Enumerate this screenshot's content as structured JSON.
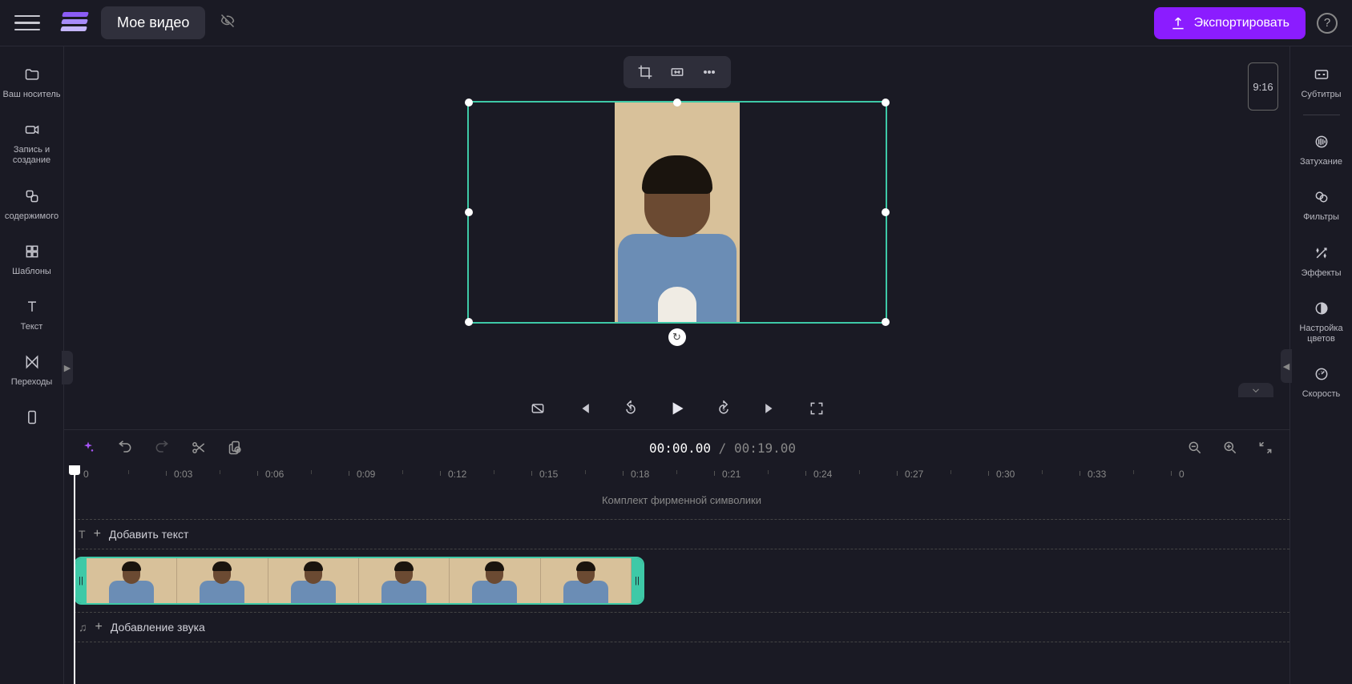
{
  "header": {
    "title": "Мое видео",
    "export_label": "Экспортировать"
  },
  "left_sidebar": {
    "items": [
      {
        "label": "Ваш носитель"
      },
      {
        "label": "Запись и создание"
      },
      {
        "label": "содержимого"
      },
      {
        "label": "Шаблоны"
      },
      {
        "label": "Текст"
      },
      {
        "label": "Переходы"
      }
    ]
  },
  "right_sidebar": {
    "items": [
      {
        "label": "Субтитры"
      },
      {
        "label": "Затухание"
      },
      {
        "label": "Фильтры"
      },
      {
        "label": "Эффекты"
      },
      {
        "label": "Настройка цветов"
      },
      {
        "label": "Скорость"
      }
    ]
  },
  "preview": {
    "aspect": "9:16"
  },
  "timeline": {
    "current": "00:00.00",
    "separator": " / ",
    "duration": "00:19.00",
    "brand_kit": "Комплект фирменной символики",
    "text_track": "Добавить текст",
    "audio_track": "Добавление звука",
    "ticks": [
      "0",
      "0:03",
      "0:06",
      "0:09",
      "0:12",
      "0:15",
      "0:18",
      "0:21",
      "0:24",
      "0:27",
      "0:30",
      "0:33",
      "0"
    ]
  }
}
